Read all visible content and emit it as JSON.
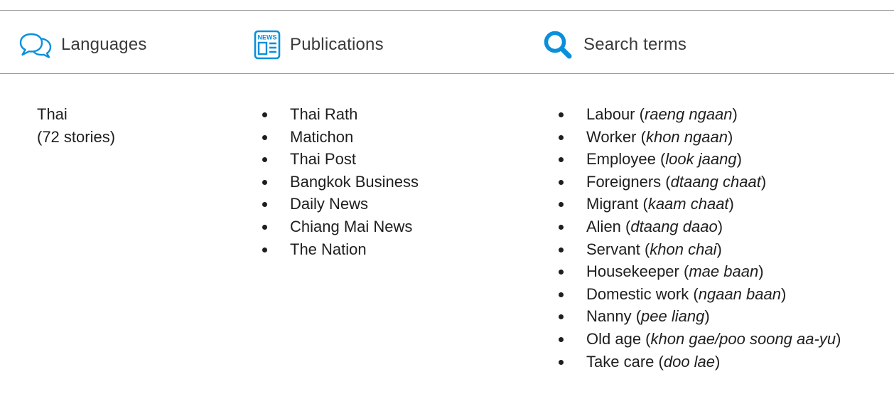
{
  "colors": {
    "accent": "#0a8fdc",
    "rule": "#9a9a9a",
    "text": "#1e1e1e"
  },
  "header": {
    "languages": {
      "icon": "speech-bubbles-icon",
      "label": "Languages"
    },
    "publications": {
      "icon": "newspaper-icon",
      "icon_text": "NEWS",
      "label": "Publications"
    },
    "search": {
      "icon": "magnifier-icon",
      "label": "Search terms"
    }
  },
  "languages": {
    "name": "Thai",
    "count": "(72 stories)"
  },
  "publications": [
    "Thai Rath",
    "Matichon",
    "Thai Post",
    "Bangkok Business",
    "Daily News",
    "Chiang Mai News",
    "The Nation"
  ],
  "search_terms": [
    {
      "english": "Labour",
      "native": "raeng ngaan"
    },
    {
      "english": "Worker",
      "native": "khon ngaan"
    },
    {
      "english": "Employee",
      "native": "look jaang"
    },
    {
      "english": "Foreigners",
      "native": "dtaang chaat"
    },
    {
      "english": "Migrant",
      "native": "kaam chaat"
    },
    {
      "english": "Alien",
      "native": "dtaang daao"
    },
    {
      "english": "Servant",
      "native": "khon chai"
    },
    {
      "english": "Housekeeper",
      "native": "mae baan"
    },
    {
      "english": "Domestic work",
      "native": "ngaan baan"
    },
    {
      "english": "Nanny",
      "native": "pee liang"
    },
    {
      "english": "Old age",
      "native": "khon gae/poo soong aa-yu"
    },
    {
      "english": "Take care",
      "native": "doo lae"
    }
  ]
}
